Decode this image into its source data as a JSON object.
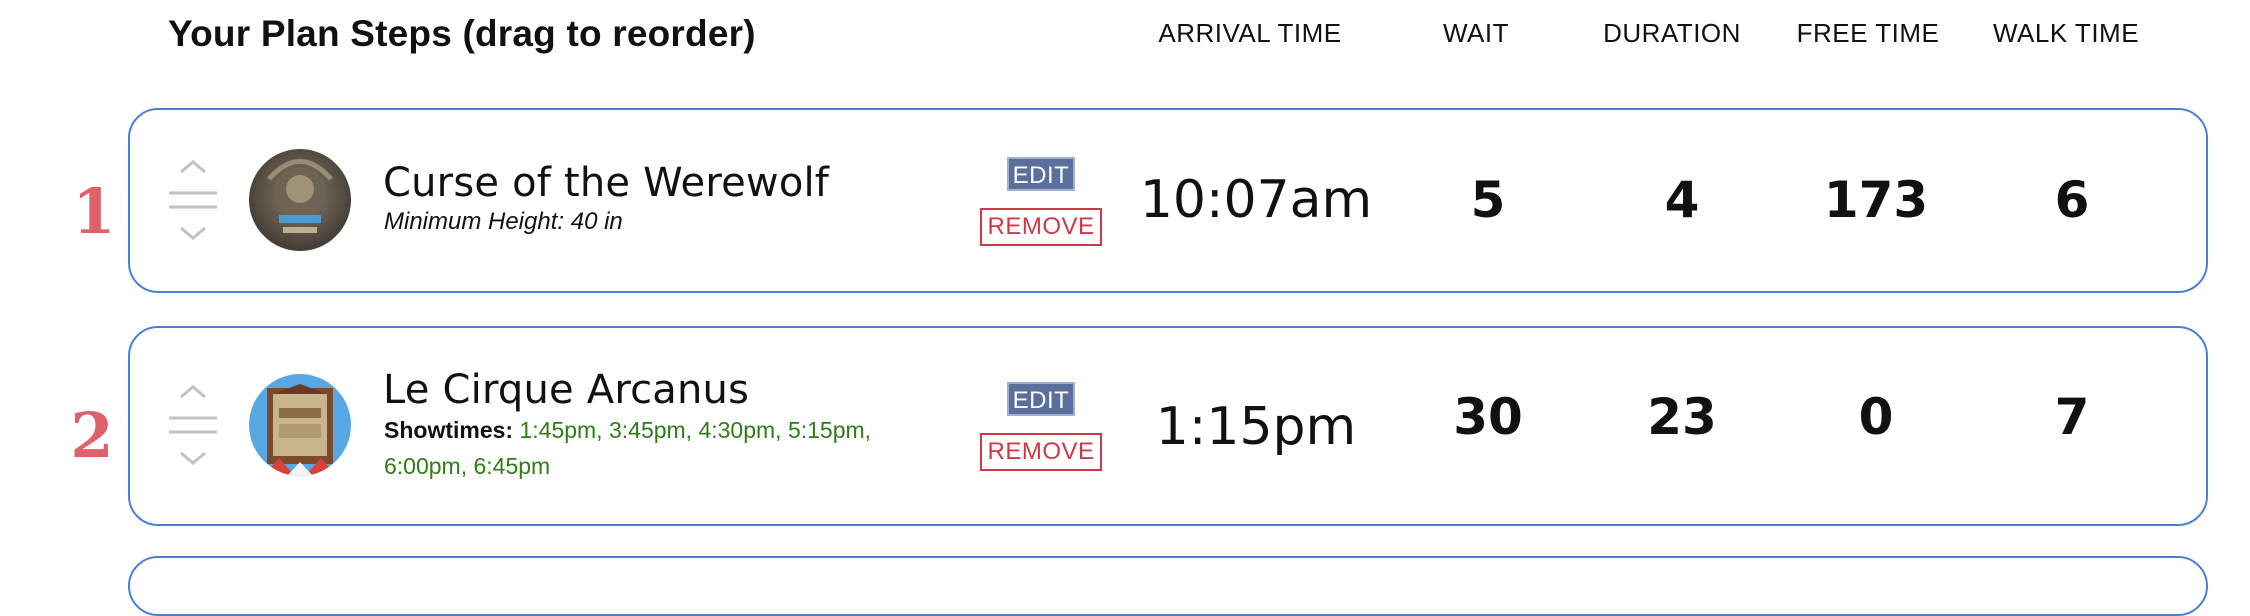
{
  "header": {
    "title": "Your Plan Steps (drag to reorder)",
    "columns": {
      "arrival": "ARRIVAL TIME",
      "wait": "WAIT",
      "duration": "DURATION",
      "free": "FREE TIME",
      "walk": "WALK TIME"
    }
  },
  "steps": [
    {
      "number": "1",
      "name": "Curse of the Werewolf",
      "subtitle": "Minimum Height: 40 in",
      "edit_label": "EDIT",
      "remove_label": "REMOVE",
      "arrival": "10:07am",
      "wait": "5",
      "duration": "4",
      "free": "173",
      "walk": "6"
    },
    {
      "number": "2",
      "name": "Le Cirque Arcanus",
      "showtimes_label": "Showtimes:",
      "showtimes": "1:45pm, 3:45pm, 4:30pm, 5:15pm, 6:00pm, 6:45pm",
      "edit_label": "EDIT",
      "remove_label": "REMOVE",
      "arrival": "1:15pm",
      "wait": "30",
      "duration": "23",
      "free": "0",
      "walk": "7"
    }
  ],
  "colors": {
    "card_border": "#4a80d8",
    "step_number": "#e0606c",
    "edit_bg": "#5a6f9c",
    "remove": "#d0384a",
    "showtimes": "#2e7d17"
  },
  "icons": {
    "drag_handle": "drag-handle-icon"
  }
}
